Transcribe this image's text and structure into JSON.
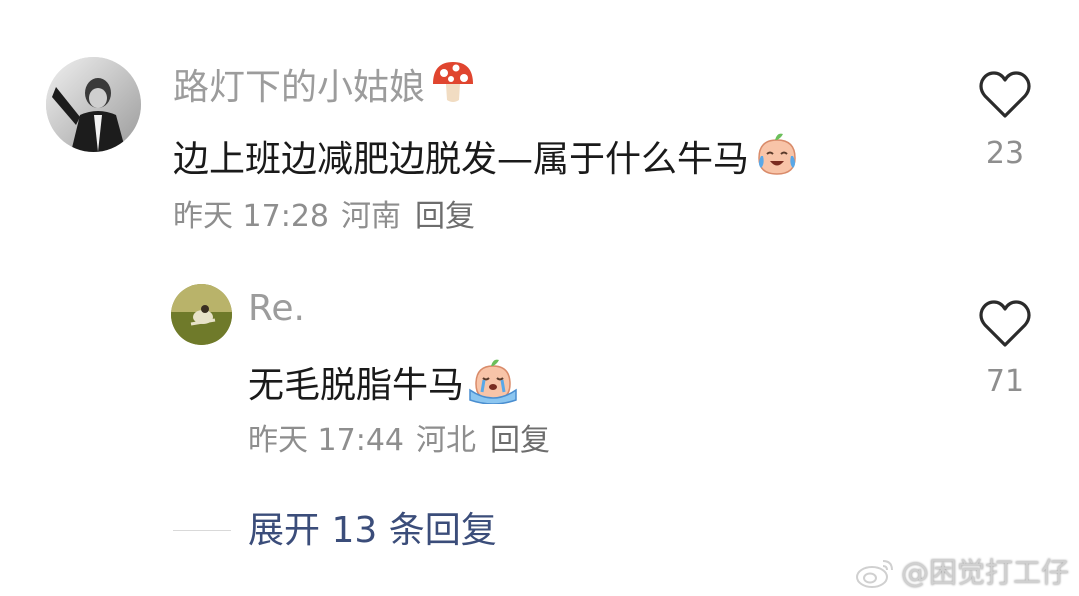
{
  "comments": [
    {
      "username": "路灯下的小姑娘",
      "username_badge": "mushroom-icon",
      "text": "边上班边减肥边脱发—属于什么牛马",
      "text_emoji": "laughing-tears-peach-icon",
      "time": "昨天 17:28",
      "location": "河南",
      "reply_label": "回复",
      "likes": "23"
    }
  ],
  "reply": {
    "username": "Re.",
    "text": "无毛脱脂牛马",
    "text_emoji": "crying-peach-icon",
    "time": "昨天 17:44",
    "location": "河北",
    "reply_label": "回复",
    "likes": "71"
  },
  "expand_replies": "展开 13 条回复",
  "watermark": "@困觉打工仔",
  "colors": {
    "username": "#9c9c9c",
    "text": "#1a1a1a",
    "meta": "#8e8e8e",
    "expand": "#3b4d7a"
  }
}
